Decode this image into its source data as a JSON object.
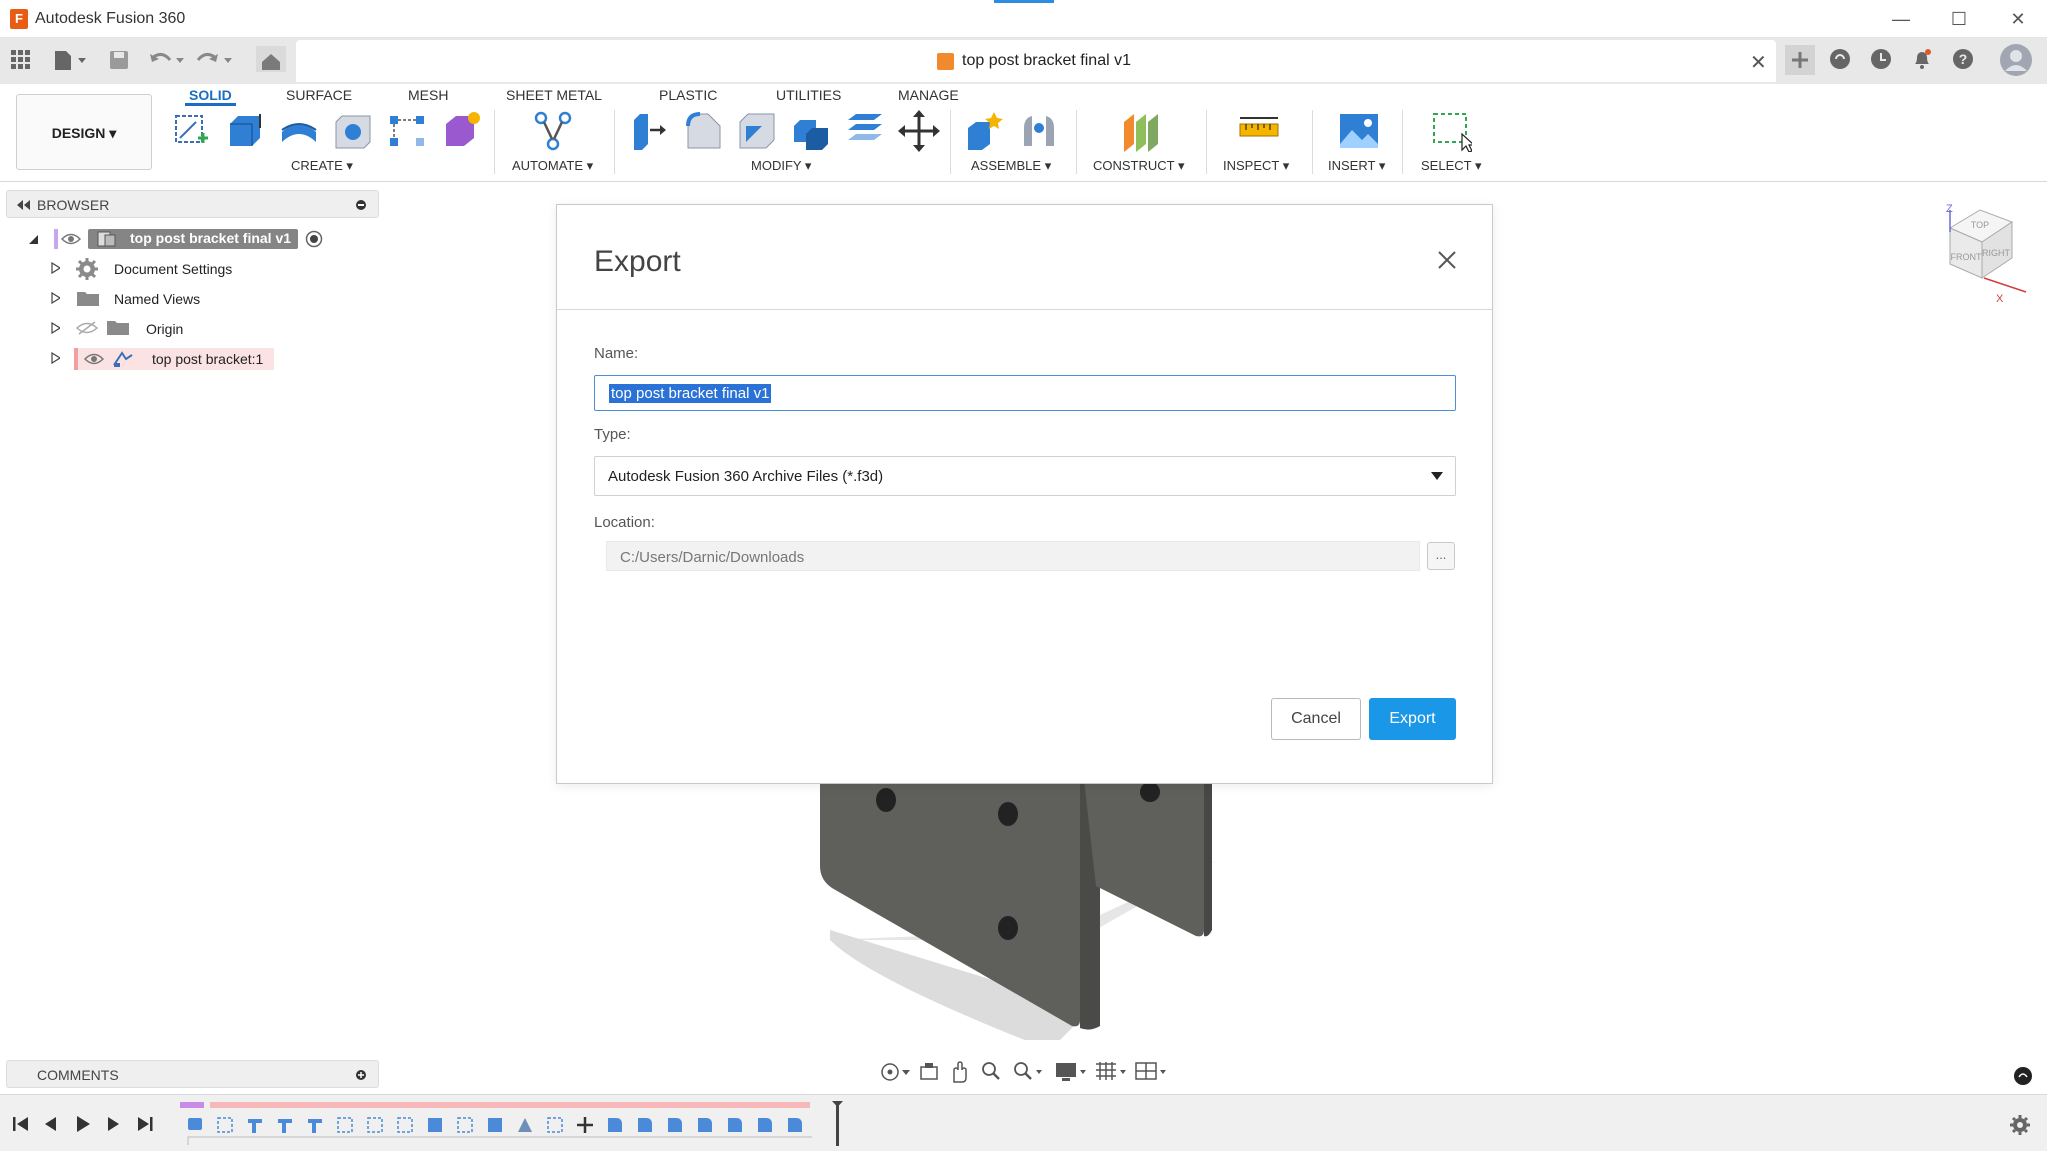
{
  "app": {
    "window_title": "Autodesk Fusion 360",
    "logo_letter": "F",
    "document_title": "top post bracket final v1"
  },
  "ribbon": {
    "workspace_button": "DESIGN ▾",
    "tabs": [
      {
        "label": "SOLID",
        "active": true
      },
      {
        "label": "SURFACE"
      },
      {
        "label": "MESH"
      },
      {
        "label": "SHEET METAL"
      },
      {
        "label": "PLASTIC"
      },
      {
        "label": "UTILITIES"
      },
      {
        "label": "MANAGE"
      }
    ],
    "groups": [
      "CREATE ▾",
      "AUTOMATE ▾",
      "MODIFY ▾",
      "ASSEMBLE ▾",
      "CONSTRUCT ▾",
      "INSPECT ▾",
      "INSERT ▾",
      "SELECT ▾"
    ]
  },
  "browser": {
    "header": "BROWSER",
    "root": "top post bracket final v1",
    "items": [
      "Document Settings",
      "Named Views",
      "Origin",
      "top post bracket:1"
    ]
  },
  "comments": {
    "header": "COMMENTS"
  },
  "viewcube": {
    "faces": [
      "TOP",
      "FRONT",
      "RIGHT"
    ],
    "axes": [
      "Z",
      "X"
    ]
  },
  "dialog": {
    "title": "Export",
    "name_label": "Name:",
    "name_value": "top post bracket final v1",
    "type_label": "Type:",
    "type_value": "Autodesk Fusion 360 Archive Files (*.f3d)",
    "location_label": "Location:",
    "location_value": "C:/Users/Darnic/Downloads",
    "browse_label": "...",
    "cancel_label": "Cancel",
    "export_label": "Export"
  },
  "colors": {
    "accent": "#1a97e6",
    "tab_active": "#1a6fc4",
    "brand_orange": "#e85d13",
    "model_gray": "#5f5f5c"
  }
}
